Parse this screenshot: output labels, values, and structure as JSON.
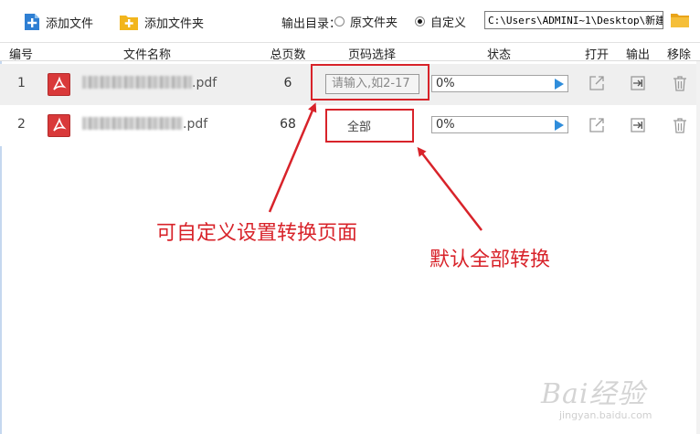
{
  "toolbar": {
    "add_file_label": "添加文件",
    "add_folder_label": "添加文件夹",
    "output_dir_label": "输出目录：",
    "radio_original_label": "原文件夹",
    "radio_custom_label": "自定义",
    "selected_output": "自定义",
    "output_path": "C:\\Users\\ADMINI~1\\Desktop\\新建文"
  },
  "table": {
    "columns": [
      "编号",
      "文件名称",
      "总页数",
      "页码选择",
      "状态",
      "打开",
      "输出",
      "移除"
    ],
    "rows": [
      {
        "index": "1",
        "filename_suffix": ".pdf",
        "pages": "6",
        "page_select_placeholder": "请输入,如2-17",
        "status": "0%"
      },
      {
        "index": "2",
        "filename_suffix": ".pdf",
        "pages": "68",
        "page_select_value": "全部",
        "status": "0%"
      }
    ]
  },
  "annotations": {
    "custom_pages": "可自定义设置转换页面",
    "default_all": "默认全部转换"
  },
  "watermark": {
    "logo": "Bai经验",
    "sub": "jingyan.baidu.com"
  },
  "icons": [
    "add-file-icon",
    "add-folder-icon",
    "folder-browse-icon",
    "pdf-file-icon",
    "play-icon",
    "open-external-icon",
    "output-icon",
    "trash-icon"
  ],
  "colors": {
    "accent_blue": "#2f8ddb",
    "annotation_red": "#d8232a",
    "pdf_red": "#d9393a",
    "folder_yellow": "#f2b51c"
  }
}
